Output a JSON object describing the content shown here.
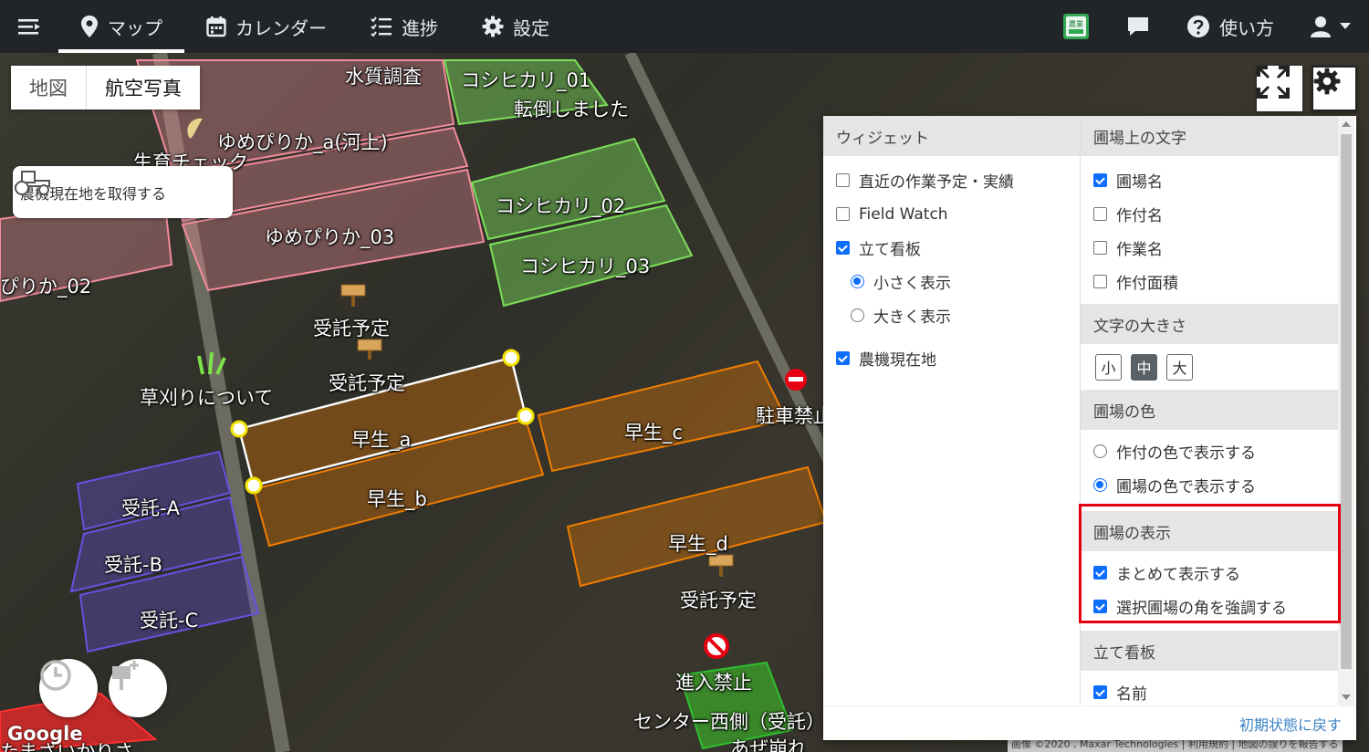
{
  "nav": {
    "items": [
      {
        "label": "マップ",
        "icon": "map-pin-icon"
      },
      {
        "label": "カレンダー",
        "icon": "calendar-icon"
      },
      {
        "label": "進捗",
        "icon": "list-icon"
      },
      {
        "label": "設定",
        "icon": "gear-icon"
      }
    ],
    "help_label": "使い方",
    "farm_badge": "農業",
    "active": "マップ"
  },
  "map": {
    "toggle": {
      "map": "地図",
      "satellite": "航空写真"
    },
    "tractor_button": "農機現在地を取得する",
    "fields": {
      "f1": "水質調査",
      "f2": "コシヒカリ_01",
      "f3": "転倒しました",
      "f4": "ゆめぴりか_a(河上)",
      "f5": "生育チェック",
      "f6": "コシヒカリ_02",
      "f7": "ゆめぴりか_03",
      "f8": "コシヒカリ_03",
      "f9": "ぴりか_02",
      "f10": "受託予定",
      "f11": "受託予定",
      "f12": "草刈りについて",
      "f13": "早生_a",
      "f14": "早生_c",
      "f15": "駐車禁止",
      "f16": "早生_b",
      "f17": "受託-A",
      "f18": "受託-B",
      "f19": "受託-C",
      "f20": "早生_d",
      "f21": "受託予定",
      "f22": "進入禁止",
      "f23": "センター西側（受託）",
      "f24": "あぜ崩れ",
      "f25": "たまざいかりさ"
    },
    "google": "Google",
    "attribution": "画像 ©2020 , Maxar Technologies | 利用規約 | 地図の誤りを報告する"
  },
  "panel": {
    "left": {
      "header": "ウィジェット",
      "items": [
        {
          "label": "直近の作業予定・実績",
          "checked": false
        },
        {
          "label": "Field Watch",
          "checked": false
        },
        {
          "label": "立て看板",
          "checked": true
        },
        {
          "label": "小さく表示",
          "radio": true,
          "selected": true
        },
        {
          "label": "大きく表示",
          "radio": true,
          "selected": false
        },
        {
          "label": "農機現在地",
          "checked": true
        }
      ]
    },
    "right": {
      "field_text": {
        "header": "圃場上の文字",
        "items": [
          {
            "label": "圃場名",
            "checked": true
          },
          {
            "label": "作付名",
            "checked": false
          },
          {
            "label": "作業名",
            "checked": false
          },
          {
            "label": "作付面積",
            "checked": false
          }
        ]
      },
      "font_size": {
        "header": "文字の大きさ",
        "options": [
          "小",
          "中",
          "大"
        ],
        "selected": "中"
      },
      "field_color": {
        "header": "圃場の色",
        "items": [
          {
            "label": "作付の色で表示する",
            "selected": false
          },
          {
            "label": "圃場の色で表示する",
            "selected": true
          }
        ]
      },
      "field_display": {
        "header": "圃場の表示",
        "items": [
          {
            "label": "まとめて表示する",
            "checked": true
          },
          {
            "label": "選択圃場の角を強調する",
            "checked": true
          }
        ]
      },
      "signboard": {
        "header": "立て看板",
        "items": [
          {
            "label": "名前",
            "checked": true
          }
        ]
      }
    },
    "reset": "初期状態に戻す"
  },
  "colors": {
    "nav_bg": "#212529",
    "pink_field": "#f28b9a",
    "green_field": "#7ddf5a",
    "orange_field": "#f07d00",
    "purple_field": "#6a4fe0",
    "highlight": "#e60012",
    "link": "#3b82c4"
  }
}
